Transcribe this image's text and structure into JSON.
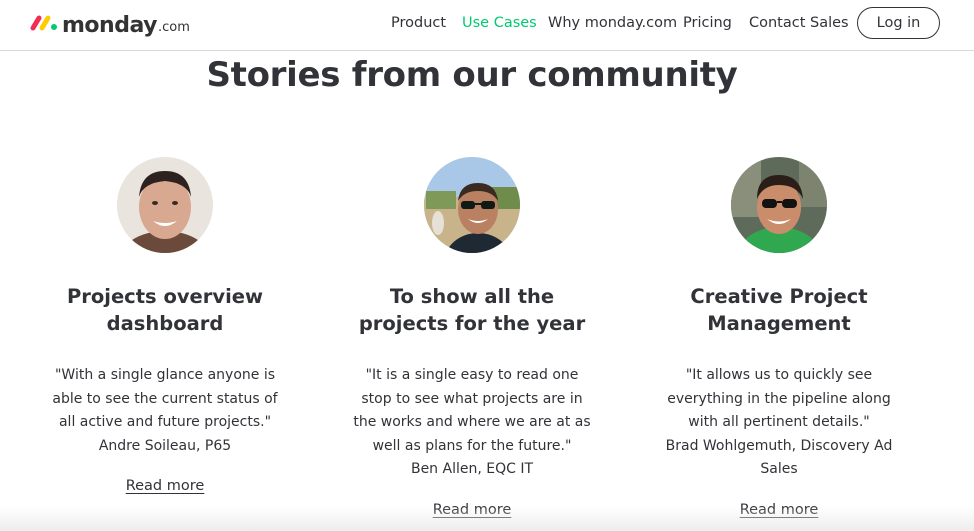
{
  "header": {
    "logo_text": "monday",
    "logo_suffix": ".com",
    "nav": [
      {
        "label": "Product",
        "active": false
      },
      {
        "label": "Use Cases",
        "active": true
      },
      {
        "label": "Why monday.com",
        "active": false
      },
      {
        "label": "Pricing",
        "active": false
      },
      {
        "label": "Contact Sales",
        "active": false
      }
    ],
    "login_label": "Log in"
  },
  "section": {
    "title": "Stories from our community"
  },
  "cards": [
    {
      "title": "Projects overview dashboard",
      "quote": "\"With a single glance anyone is able to see the current status of all active and future projects.\"",
      "author": "Andre Soileau, P65",
      "link": "Read more",
      "avatar_icon": "person-photo-icon"
    },
    {
      "title": "To show all the projects for the year",
      "quote": "\"It is a single easy to read one stop to see what projects are in the works and where we are at as well as plans for the future.\"",
      "author": "Ben Allen, EQC IT",
      "link": "Read more",
      "avatar_icon": "person-photo-icon"
    },
    {
      "title": "Creative Project Management",
      "quote": "\"It allows us to quickly see everything in the pipeline along with all pertinent details.\"",
      "author": "Brad Wohlgemuth, Discovery Ad Sales",
      "link": "Read more",
      "avatar_icon": "person-photo-icon"
    }
  ],
  "colors": {
    "accent_green": "#00ca72",
    "text": "#323338",
    "logo_red": "#f62b54",
    "logo_yellow": "#ffcc00",
    "logo_green": "#00ca72"
  }
}
